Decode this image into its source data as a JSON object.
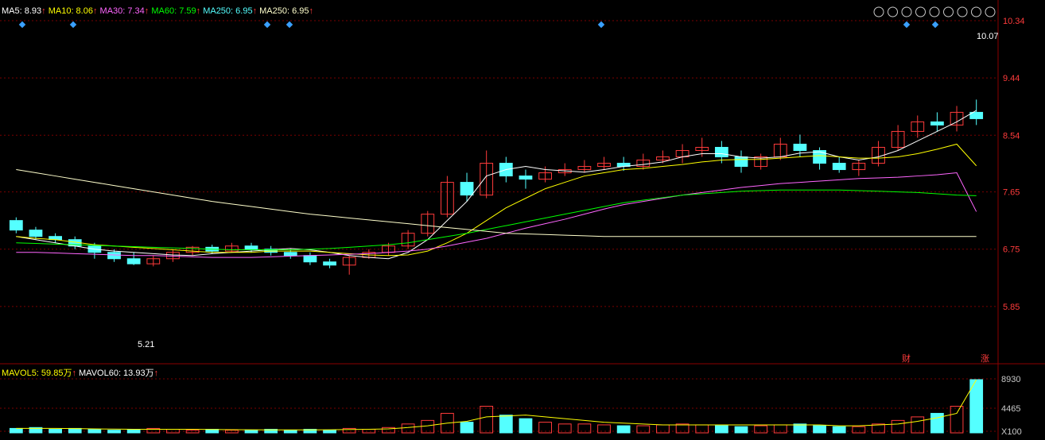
{
  "colors": {
    "up": "#ff3b3b",
    "down": "#54ffff",
    "grid": "#7a0000",
    "axis_text": "#c8c8c8",
    "ma5": "#ffffff",
    "ma10": "#ffff00",
    "ma30": "#ff66ff",
    "ma60": "#00ff00",
    "ma250": "#ffffcc"
  },
  "legend": {
    "ma5": "MA5: 8.93",
    "ma10": "MA10: 8.06",
    "ma30": "MA30: 7.34",
    "ma60": "MA60: 7.59",
    "ma250a": "MA250: 6.95",
    "ma250b": "MA250: 6.95",
    "arrow": "↑"
  },
  "vol_legend": {
    "mavol5": "MAVOL5: 59.85万",
    "mavol60": "MAVOL60: 13.93万",
    "arrow": "↑"
  },
  "toolbar_icons": [
    "eye-icon",
    "hand-icon",
    "play-icon",
    "undo-icon",
    "scissors-icon",
    "lock-icon",
    "copy-icon",
    "zoom-in-icon",
    "zoom-out-icon"
  ],
  "annotations": {
    "high_price": "10.07",
    "low_price": "5.21",
    "badge_cai": "财",
    "badge_zhang": "涨"
  },
  "chart_data": {
    "type": "candlestick",
    "price_axis": {
      "ticks": [
        "10.34",
        "9.44",
        "8.54",
        "7.65",
        "6.75",
        "5.85"
      ],
      "ylim": [
        4.95,
        10.34
      ]
    },
    "volume_axis": {
      "ticks": [
        "8930",
        "4465",
        "X100"
      ]
    },
    "candles": [
      [
        7.2,
        7.05,
        7.25,
        7.0
      ],
      [
        7.05,
        6.95,
        7.1,
        6.9
      ],
      [
        6.95,
        6.9,
        7.0,
        6.85
      ],
      [
        6.9,
        6.8,
        6.95,
        6.75
      ],
      [
        6.8,
        6.7,
        6.85,
        6.6
      ],
      [
        6.7,
        6.6,
        6.75,
        6.55
      ],
      [
        6.6,
        6.52,
        6.7,
        6.5
      ],
      [
        6.52,
        6.6,
        6.65,
        6.48
      ],
      [
        6.6,
        6.7,
        6.75,
        6.55
      ],
      [
        6.7,
        6.78,
        6.8,
        6.65
      ],
      [
        6.78,
        6.72,
        6.82,
        6.68
      ],
      [
        6.72,
        6.8,
        6.85,
        6.7
      ],
      [
        6.8,
        6.75,
        6.85,
        6.7
      ],
      [
        6.75,
        6.7,
        6.8,
        6.65
      ],
      [
        6.7,
        6.65,
        6.75,
        6.6
      ],
      [
        6.65,
        6.55,
        6.7,
        6.5
      ],
      [
        6.55,
        6.5,
        6.6,
        6.45
      ],
      [
        6.5,
        6.62,
        6.65,
        6.35
      ],
      [
        6.62,
        6.7,
        6.75,
        6.6
      ],
      [
        6.7,
        6.8,
        6.85,
        6.65
      ],
      [
        6.8,
        7.0,
        7.05,
        6.75
      ],
      [
        7.0,
        7.3,
        7.35,
        6.95
      ],
      [
        7.3,
        7.8,
        7.9,
        7.25
      ],
      [
        7.8,
        7.6,
        7.95,
        7.5
      ],
      [
        7.6,
        8.1,
        8.3,
        7.55
      ],
      [
        8.1,
        7.9,
        8.2,
        7.8
      ],
      [
        7.9,
        7.85,
        8.0,
        7.7
      ],
      [
        7.85,
        7.95,
        8.05,
        7.8
      ],
      [
        7.95,
        8.0,
        8.1,
        7.9
      ],
      [
        8.0,
        8.05,
        8.15,
        7.95
      ],
      [
        8.05,
        8.1,
        8.2,
        8.0
      ],
      [
        8.1,
        8.05,
        8.2,
        7.98
      ],
      [
        8.05,
        8.15,
        8.25,
        8.0
      ],
      [
        8.15,
        8.2,
        8.3,
        8.1
      ],
      [
        8.2,
        8.3,
        8.4,
        8.1
      ],
      [
        8.3,
        8.35,
        8.5,
        8.2
      ],
      [
        8.35,
        8.2,
        8.45,
        8.1
      ],
      [
        8.2,
        8.05,
        8.3,
        7.95
      ],
      [
        8.05,
        8.2,
        8.25,
        8.0
      ],
      [
        8.2,
        8.4,
        8.5,
        8.15
      ],
      [
        8.4,
        8.3,
        8.55,
        8.2
      ],
      [
        8.3,
        8.1,
        8.35,
        8.0
      ],
      [
        8.1,
        8.0,
        8.2,
        7.95
      ],
      [
        8.0,
        8.1,
        8.15,
        7.9
      ],
      [
        8.1,
        8.35,
        8.45,
        8.05
      ],
      [
        8.35,
        8.6,
        8.7,
        8.3
      ],
      [
        8.6,
        8.75,
        8.85,
        8.5
      ],
      [
        8.75,
        8.7,
        8.9,
        8.6
      ],
      [
        8.7,
        8.9,
        9.0,
        8.6
      ],
      [
        8.9,
        8.8,
        9.1,
        8.7
      ]
    ],
    "ma_series": [
      {
        "name": "MA5",
        "values": [
          6.95,
          6.9,
          6.85,
          6.8,
          6.75,
          6.72,
          6.7,
          6.68,
          6.66,
          6.65,
          6.68,
          6.7,
          6.72,
          6.74,
          6.76,
          6.74,
          6.7,
          6.65,
          6.62,
          6.6,
          6.7,
          6.9,
          7.2,
          7.5,
          7.9,
          8.0,
          8.05,
          8.0,
          7.98,
          7.96,
          8.0,
          8.05,
          8.08,
          8.12,
          8.2,
          8.25,
          8.25,
          8.2,
          8.18,
          8.2,
          8.26,
          8.28,
          8.2,
          8.15,
          8.2,
          8.3,
          8.45,
          8.6,
          8.75,
          8.93
        ]
      },
      {
        "name": "MA10",
        "values": [
          6.95,
          6.92,
          6.9,
          6.86,
          6.82,
          6.8,
          6.78,
          6.76,
          6.74,
          6.72,
          6.7,
          6.7,
          6.7,
          6.72,
          6.72,
          6.72,
          6.7,
          6.68,
          6.66,
          6.65,
          6.66,
          6.72,
          6.85,
          7.0,
          7.2,
          7.4,
          7.55,
          7.7,
          7.8,
          7.9,
          7.95,
          8.0,
          8.02,
          8.05,
          8.08,
          8.12,
          8.15,
          8.16,
          8.16,
          8.18,
          8.2,
          8.22,
          8.2,
          8.18,
          8.18,
          8.2,
          8.25,
          8.32,
          8.4,
          8.06
        ]
      },
      {
        "name": "MA30",
        "values": [
          6.7,
          6.7,
          6.69,
          6.68,
          6.67,
          6.66,
          6.65,
          6.65,
          6.64,
          6.63,
          6.62,
          6.62,
          6.62,
          6.63,
          6.64,
          6.65,
          6.66,
          6.67,
          6.68,
          6.7,
          6.72,
          6.75,
          6.8,
          6.86,
          6.92,
          7.0,
          7.08,
          7.15,
          7.22,
          7.3,
          7.38,
          7.45,
          7.5,
          7.55,
          7.6,
          7.64,
          7.68,
          7.72,
          7.75,
          7.78,
          7.8,
          7.82,
          7.84,
          7.86,
          7.87,
          7.88,
          7.9,
          7.92,
          7.95,
          7.34
        ]
      },
      {
        "name": "MA60",
        "values": [
          6.85,
          6.84,
          6.83,
          6.82,
          6.81,
          6.8,
          6.79,
          6.78,
          6.77,
          6.76,
          6.75,
          6.74,
          6.74,
          6.74,
          6.74,
          6.75,
          6.76,
          6.78,
          6.8,
          6.82,
          6.85,
          6.9,
          6.95,
          7.0,
          7.06,
          7.12,
          7.18,
          7.24,
          7.3,
          7.36,
          7.42,
          7.48,
          7.52,
          7.56,
          7.6,
          7.62,
          7.64,
          7.66,
          7.67,
          7.68,
          7.68,
          7.68,
          7.68,
          7.67,
          7.66,
          7.65,
          7.64,
          7.62,
          7.6,
          7.59
        ]
      },
      {
        "name": "MA250",
        "values": [
          8.0,
          7.95,
          7.9,
          7.85,
          7.8,
          7.75,
          7.7,
          7.65,
          7.6,
          7.55,
          7.5,
          7.46,
          7.42,
          7.38,
          7.34,
          7.3,
          7.27,
          7.24,
          7.21,
          7.18,
          7.15,
          7.12,
          7.09,
          7.06,
          7.03,
          7.0,
          6.99,
          6.98,
          6.97,
          6.96,
          6.95,
          6.95,
          6.95,
          6.95,
          6.95,
          6.95,
          6.95,
          6.95,
          6.95,
          6.95,
          6.95,
          6.95,
          6.95,
          6.95,
          6.95,
          6.95,
          6.95,
          6.95,
          6.95,
          6.95
        ]
      }
    ],
    "volume": [
      5,
      6,
      4,
      5,
      4,
      3,
      4,
      5,
      4,
      3,
      4,
      3,
      3,
      4,
      3,
      4,
      3,
      5,
      4,
      6,
      10,
      14,
      22,
      12,
      30,
      20,
      16,
      12,
      10,
      10,
      9,
      8,
      8,
      9,
      10,
      9,
      8,
      7,
      8,
      9,
      10,
      8,
      7,
      7,
      10,
      14,
      18,
      22,
      30,
      60
    ],
    "volume_ma5": [
      5,
      5,
      5,
      4.8,
      4.5,
      4.2,
      4,
      4,
      4,
      4,
      3.8,
      3.6,
      3.5,
      3.4,
      3.4,
      3.4,
      3.5,
      3.8,
      4,
      4.5,
      6,
      8,
      11,
      13,
      18,
      19,
      20,
      18,
      16,
      14,
      12,
      11,
      10,
      9,
      9,
      9,
      9,
      9,
      9,
      9,
      9,
      9,
      8,
      8,
      9,
      10,
      13,
      17,
      22,
      59.85
    ]
  }
}
